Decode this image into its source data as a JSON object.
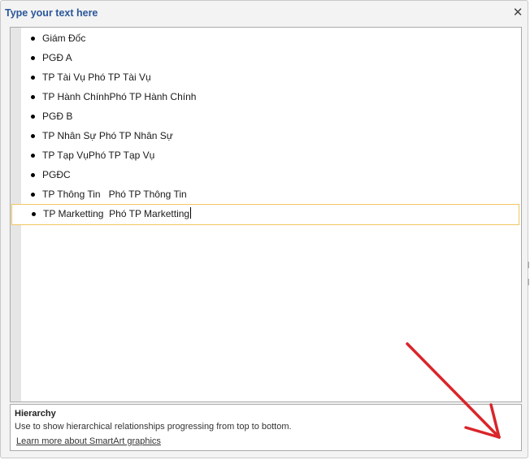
{
  "pane": {
    "title": "Type your text here",
    "close_glyph": "✕"
  },
  "items": [
    "Giám Đốc",
    "PGĐ A",
    "TP Tài Vụ Phó TP Tài Vụ",
    "TP Hành ChínhPhó TP Hành Chính",
    "PGĐ B",
    "TP Nhân Sự Phó TP Nhân Sự",
    "TP Tạp VụPhó TP Tạp Vụ",
    "PGĐC",
    "TP Thông Tin   Phó TP Thông Tin",
    "TP Marketting  Phó TP Marketting"
  ],
  "description": {
    "title": "Hierarchy",
    "text": "Use to show hierarchical relationships progressing from top to bottom.",
    "link": "Learn more about SmartArt graphics"
  },
  "annotation": {
    "arrow_color": "#d9252a"
  }
}
